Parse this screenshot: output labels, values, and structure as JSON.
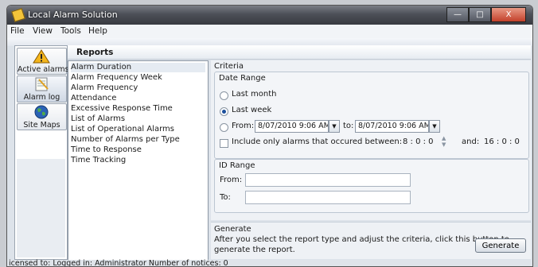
{
  "window": {
    "title": "Local Alarm Solution",
    "min_glyph": "—",
    "max_glyph": "□",
    "close_glyph": "X"
  },
  "menu": {
    "file": "File",
    "view": "View",
    "tools": "Tools",
    "help": "Help"
  },
  "sidebar": {
    "items": [
      {
        "label": "Active alarms",
        "icon": "warning-icon"
      },
      {
        "label": "Alarm log",
        "icon": "log-icon"
      },
      {
        "label": "Site Maps",
        "icon": "globe-icon"
      }
    ]
  },
  "reports": {
    "title": "Reports",
    "list": [
      "Alarm Duration",
      "Alarm Frequency Week",
      "Alarm Frequency",
      "Attendance",
      "Excessive Response Time",
      "List of Alarms",
      "List of Operational Alarms",
      "Number of Alarms per Type",
      "Time to Response",
      "Time Tracking"
    ],
    "selected": "Alarm Duration"
  },
  "criteria": {
    "title": "Criteria",
    "date_range": {
      "title": "Date Range",
      "last_month": "Last month",
      "last_week": "Last week",
      "selected": "Last week",
      "from_label": "From:",
      "from_value": "8/07/2010 9:06 AM",
      "to_label": "to:",
      "to_value": "8/07/2010 9:06 AM",
      "include_label": "Include only alarms that occured between:",
      "start_time": "8  :  0  :  0",
      "and_label": "and:",
      "end_time": "16  :  0  :  0"
    },
    "id_range": {
      "title": "ID Range",
      "from_label": "From:",
      "to_label": "To:",
      "from_value": "",
      "to_value": ""
    }
  },
  "generate": {
    "title": "Generate",
    "help_line1": "After you select the report type and adjust the criteria, click this button to",
    "help_line2": "generate the report.",
    "button_label": "Generate"
  },
  "status": {
    "text": "icensed to:  Logged in:  Administrator  Number of notices:  0"
  },
  "colors": {
    "title_bar": "#4d5058",
    "selection": "#e5ebf2",
    "close_button": "#c3402a",
    "radio_dot": "#1c4f9c"
  }
}
